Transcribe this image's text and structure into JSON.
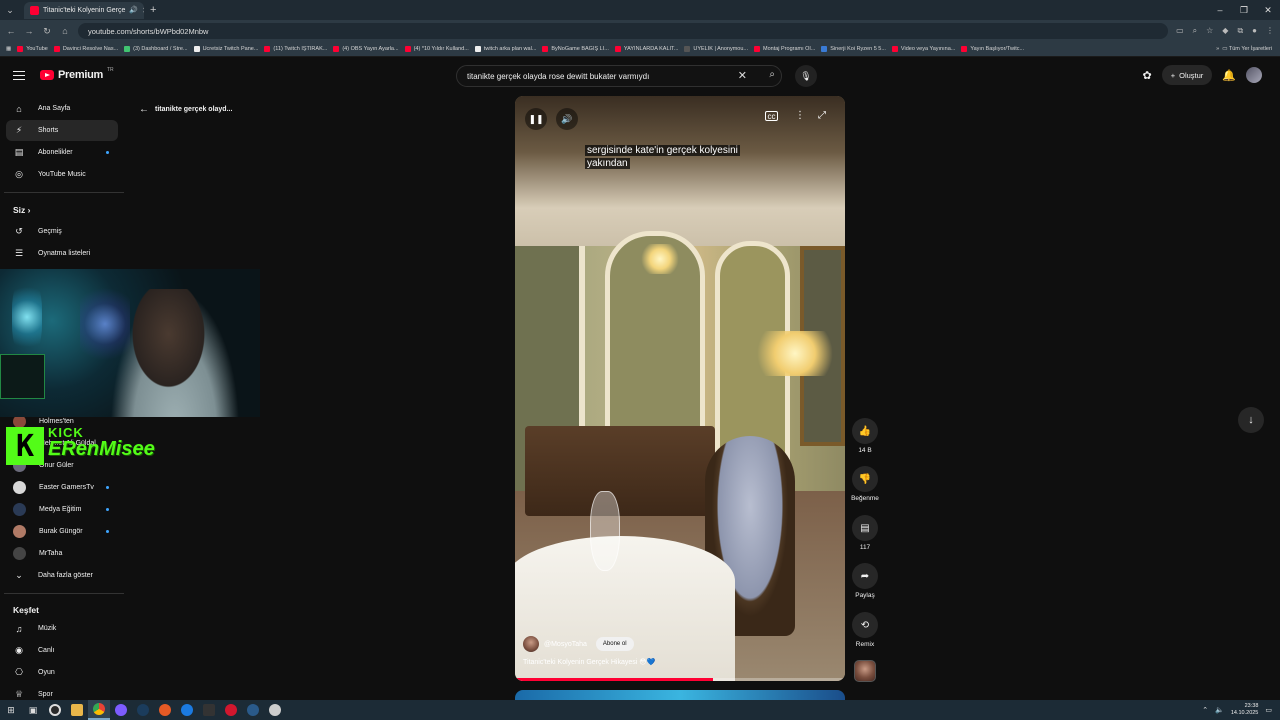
{
  "browser": {
    "tab_title": "Titanic'teki Kolyenin Gerçe",
    "url": "youtube.com/shorts/bWPbd02Mnbw",
    "bookmarks": [
      "YouTube",
      "Davinci Resolve Nas...",
      "(3) Dashboard / Stre...",
      "Ücretsiz Twitch Pane...",
      "(11) Twitch İŞTIRAK...",
      "(4) OBS Yayın Ayarla...",
      "(4) *10 Yıldır Kulland...",
      "twitch arka plan wal...",
      "ByNoGame BAĞIŞ Lİ...",
      "YAYINLARDA KALIT...",
      "ÜYELİK | Anonymou...",
      "Montaj Programı Ol...",
      "Sinerji Koi Ryzen 5 5...",
      "Video veya Yayınına...",
      "Yayın Başlıyor/Twitc..."
    ],
    "all_bookmarks": "Tüm Yer İşaretleri"
  },
  "header": {
    "logo": "Premium",
    "region": "TR",
    "search_query": "titanikte gerçek olayda rose dewitt bukater varmıydı",
    "create_label": "Oluştur"
  },
  "sidebar": {
    "main": [
      "Ana Sayfa",
      "Shorts",
      "Abonelikler",
      "YouTube Music"
    ],
    "you_heading": "Siz",
    "you_items": [
      "Geçmiş",
      "Oynatma listeleri"
    ],
    "subs": [
      "Holmes'ten",
      "Mehmet Ali Güldal",
      "Onur Güler",
      "Easter GamersTv",
      "Medya Eğitim",
      "Burak Güngör",
      "MrTaha"
    ],
    "show_more": "Daha fazla göster",
    "explore_heading": "Keşfet",
    "explore_items": [
      "Müzik",
      "Canlı",
      "Oyun",
      "Spor"
    ]
  },
  "overlay": {
    "kick_label": "KICK",
    "kick_name": "ERenMisee"
  },
  "back_link": "titanikte gerçek olayd...",
  "video": {
    "subtitle_line1": "sergisinde kate'in gerçek kolyesini",
    "subtitle_line2": "yakından",
    "channel": "@MosyoTaha",
    "subscribe": "Abone ol",
    "title": "Titanic'teki Kolyenin Gerçek Hikayesi 😳💙",
    "progress": 0.6
  },
  "actions": {
    "likes": "14 B",
    "dislike": "Beğenme",
    "comments": "117",
    "share": "Paylaş",
    "remix": "Remix"
  },
  "taskbar": {
    "time": "23:38",
    "date": "14.10.2025"
  },
  "colors": {
    "accent": "#ff0033",
    "link_dot": "#3ea6ff",
    "kick_green": "#53fc18"
  }
}
